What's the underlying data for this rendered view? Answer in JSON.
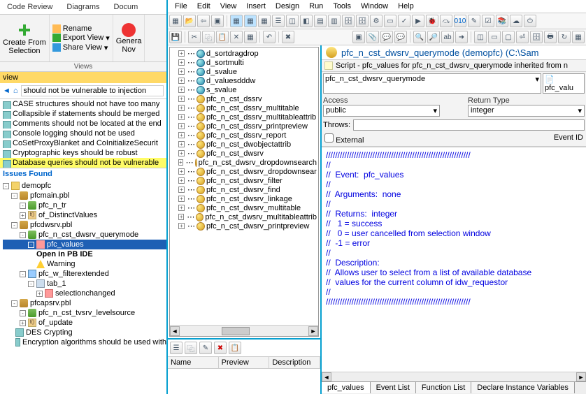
{
  "ribbon": {
    "tabs": [
      "Code Review",
      "Diagrams",
      "Docum"
    ],
    "create_from_selection": "Create From\nSelection",
    "rename": "Rename",
    "export_view": "Export View",
    "share_view": "Share View",
    "generate_now": "Genera\nNov",
    "group_label": "Views"
  },
  "view_bar": "view",
  "breadcrumb_text": "should not be vulnerable to injection",
  "rules": [
    {
      "text": "CASE structures should not have too many",
      "hl": false
    },
    {
      "text": "Collapsible if statements should be merged",
      "hl": false
    },
    {
      "text": "Comments should not be located at the end",
      "hl": false
    },
    {
      "text": "Console logging should not be used",
      "hl": false
    },
    {
      "text": "CoSetProxyBlanket and CoInitializeSecurit",
      "hl": false
    },
    {
      "text": "Cryptographic keys should be robust",
      "hl": false
    },
    {
      "text": "Database queries should not be vulnerable",
      "hl": true
    }
  ],
  "issues_header": "Issues Found",
  "tree": {
    "root": "demopfc",
    "n1": "pfcmain.pbl",
    "n1a": "pfc_n_tr",
    "n1b": "of_DistinctValues",
    "n2": "pfcdwsrv.pbl",
    "n2a": "pfc_n_cst_dwsrv_querymode",
    "n2b": "pfc_values",
    "n2c": "Open in PB IDE",
    "n2d": "Warning",
    "n2e": "pfc_w_filterextended",
    "n2f": "tab_1",
    "n2g": "selectionchanged",
    "n3": "pfcapsrv.pbl",
    "n3a": "pfc_n_cst_tvsrv_levelsource",
    "n3b": "of_update",
    "r1": "DES Crypting",
    "r2": "Encryption algorithms should be used with"
  },
  "menubar": [
    "File",
    "Edit",
    "View",
    "Insert",
    "Design",
    "Run",
    "Tools",
    "Window",
    "Help"
  ],
  "obj_tree": [
    {
      "icon": "blue",
      "label": "d_sortdragdrop"
    },
    {
      "icon": "blue",
      "label": "d_sortmulti"
    },
    {
      "icon": "blue",
      "label": "d_svalue"
    },
    {
      "icon": "blue",
      "label": "d_valuesdddw"
    },
    {
      "icon": "blue",
      "label": "s_svalue"
    },
    {
      "icon": "gold",
      "label": "pfc_n_cst_dssrv"
    },
    {
      "icon": "gold",
      "label": "pfc_n_cst_dssrv_multitable"
    },
    {
      "icon": "gold",
      "label": "pfc_n_cst_dssrv_multitableattrib"
    },
    {
      "icon": "gold",
      "label": "pfc_n_cst_dssrv_printpreview"
    },
    {
      "icon": "gold",
      "label": "pfc_n_cst_dssrv_report"
    },
    {
      "icon": "gold",
      "label": "pfc_n_cst_dwobjectattrib"
    },
    {
      "icon": "gold",
      "label": "pfc_n_cst_dwsrv"
    },
    {
      "icon": "gold",
      "label": "pfc_n_cst_dwsrv_dropdownsearch"
    },
    {
      "icon": "gold",
      "label": "pfc_n_cst_dwsrv_dropdownsear"
    },
    {
      "icon": "gold",
      "label": "pfc_n_cst_dwsrv_filter"
    },
    {
      "icon": "gold",
      "label": "pfc_n_cst_dwsrv_find"
    },
    {
      "icon": "gold",
      "label": "pfc_n_cst_dwsrv_linkage"
    },
    {
      "icon": "gold",
      "label": "pfc_n_cst_dwsrv_multitable"
    },
    {
      "icon": "gold",
      "label": "pfc_n_cst_dwsrv_multitableattrib"
    },
    {
      "icon": "gold",
      "label": "pfc_n_cst_dwsrv_printpreview"
    }
  ],
  "props_cols": [
    "Name",
    "Preview",
    "Description"
  ],
  "editor": {
    "title": "pfc_n_cst_dwsrv_querymode (demopfc) (C:\\Sam",
    "script_label": "Script - pfc_values for pfc_n_cst_dwsrv_querymode inherited from n",
    "dropdown1": "pfc_n_cst_dwsrv_querymode",
    "dropdown2": "pfc_valu",
    "access_label": "Access",
    "access_value": "public",
    "return_label": "Return Type",
    "return_value": "integer",
    "throws_label": "Throws:",
    "external_label": "External",
    "eventid_label": "Event ID",
    "code_lines": [
      "//////////////////////////////////////////////////////////////",
      "//",
      "//  Event:  pfc_values",
      "//",
      "//  Arguments:  none",
      "//",
      "//  Returns:  integer",
      "//   1 = success",
      "//   0 = user cancelled from selection window",
      "//  -1 = error",
      "//",
      "//  Description:",
      "//  Allows user to select from a list of available database",
      "//  values for the current column of idw_requestor",
      "//",
      "//////////////////////////////////////////////////////////////"
    ],
    "tabs": [
      "pfc_values",
      "Event List",
      "Function List",
      "Declare Instance Variables"
    ]
  }
}
